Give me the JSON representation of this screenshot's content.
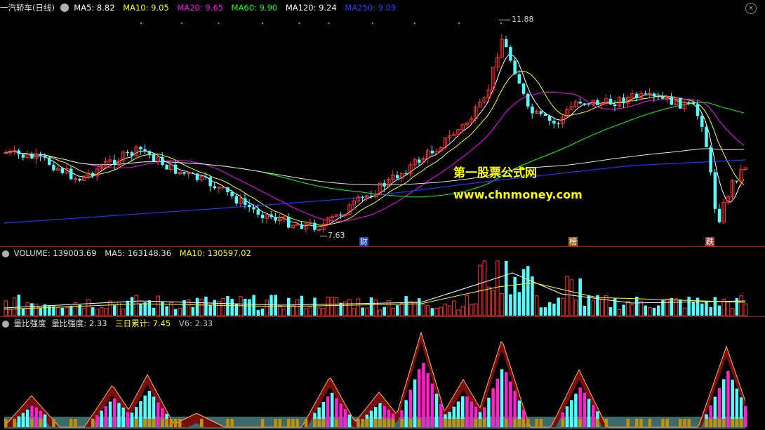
{
  "main_panel": {
    "title": "一汽轿车(日线)",
    "settings_icon": "circle-gear-icon",
    "ma": [
      {
        "label": "MA5: 8.82",
        "color": "#ffffff"
      },
      {
        "label": "MA10: 9.05",
        "color": "#ffff00"
      },
      {
        "label": "MA20: 9.65",
        "color": "#ff00ff"
      },
      {
        "label": "MA60: 9.90",
        "color": "#00ff00"
      },
      {
        "label": "MA120: 9.24",
        "color": "#ffffff"
      },
      {
        "label": "MA250: 9.09",
        "color": "#2233ff"
      }
    ],
    "high_label": "11.88",
    "low_label": "7.63",
    "event_markers": [
      "财",
      "榜",
      "跌"
    ],
    "watermark_title": "第一股票公式网",
    "watermark_url": "www.chnmoney.com"
  },
  "volume_panel": {
    "title": "VOLUME: 139003.69",
    "ma5": "MA5: 163148.36",
    "ma10": "MA10: 130597.02"
  },
  "indicator_panel": {
    "name": "量比强度",
    "value": "量比强度: 2.33",
    "three_day": "三日累计: 7.45",
    "v6": "V6: 2.33"
  },
  "colors": {
    "up": "#ff3232",
    "down": "#54ffff",
    "separator": "#b01818",
    "ma5": "#ffffff",
    "ma10": "#ffff00",
    "ma20": "#ff00ff",
    "ma60": "#00ff00",
    "ma120": "#e0e0e0",
    "ma250": "#2233ff"
  }
}
